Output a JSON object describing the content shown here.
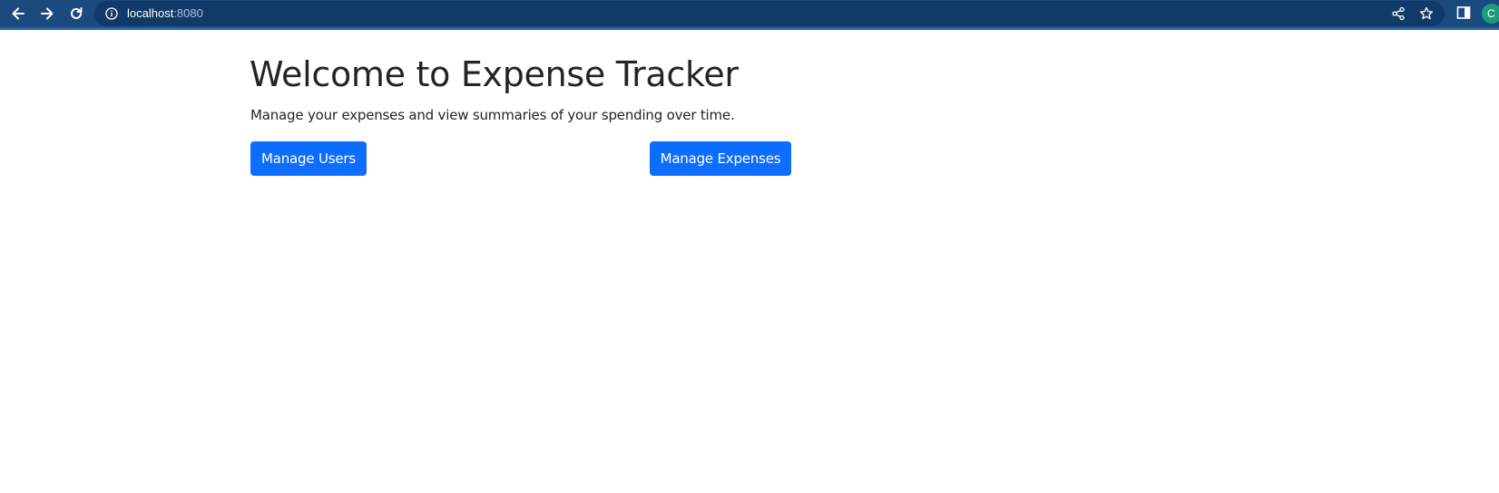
{
  "browser": {
    "url_host": "localhost",
    "url_port": ":8080",
    "profile_initial": "C",
    "icons": {
      "back": "arrow-left-icon",
      "forward": "arrow-right-icon",
      "reload": "reload-icon",
      "site_info": "info-icon",
      "share": "share-icon",
      "bookmark": "star-icon",
      "side_panel": "side-panel-icon"
    },
    "colors": {
      "toolbar": "#1b4a7e",
      "omnibox": "#123a68",
      "avatar": "#1a9e7a"
    }
  },
  "page": {
    "title": "Welcome to Expense Tracker",
    "subtitle": "Manage your expenses and view summaries of your spending over time.",
    "buttons": {
      "manage_users": "Manage Users",
      "manage_expenses": "Manage Expenses"
    },
    "colors": {
      "primary": "#0d6efd",
      "text": "#212529"
    }
  }
}
